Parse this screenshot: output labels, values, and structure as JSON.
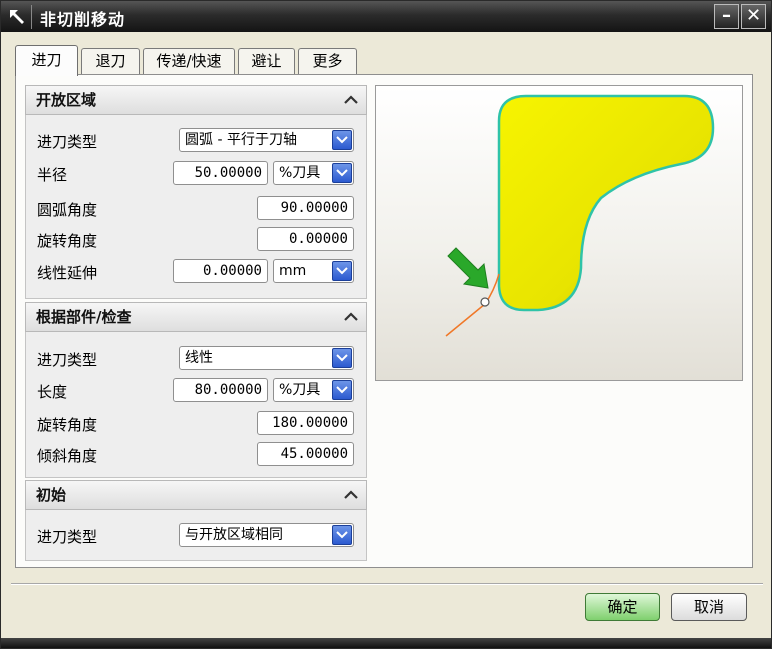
{
  "window": {
    "title": "非切削移动",
    "minimize_label": "–",
    "close_label": "✕"
  },
  "tabs": [
    {
      "label": "进刀",
      "active": true
    },
    {
      "label": "退刀",
      "active": false
    },
    {
      "label": "传递/快速",
      "active": false
    },
    {
      "label": "避让",
      "active": false
    },
    {
      "label": "更多",
      "active": false
    }
  ],
  "open_area": {
    "header": "开放区域",
    "entry_type_label": "进刀类型",
    "entry_type_value": "圆弧 - 平行于刀轴",
    "radius_label": "半径",
    "radius_value": "50.00000",
    "radius_unit": "%刀具",
    "arc_angle_label": "圆弧角度",
    "arc_angle_value": "90.00000",
    "rotation_angle_label": "旋转角度",
    "rotation_angle_value": "0.00000",
    "linear_extension_label": "线性延伸",
    "linear_extension_value": "0.00000",
    "linear_extension_unit": "mm"
  },
  "part_check": {
    "header": "根据部件/检查",
    "entry_type_label": "进刀类型",
    "entry_type_value": "线性",
    "length_label": "长度",
    "length_value": "80.00000",
    "length_unit": "%刀具",
    "rotation_angle_label": "旋转角度",
    "rotation_angle_value": "180.00000",
    "ramp_angle_label": "倾斜角度",
    "ramp_angle_value": "45.00000"
  },
  "initial": {
    "header": "初始",
    "entry_type_label": "进刀类型",
    "entry_type_value": "与开放区域相同"
  },
  "buttons": {
    "ok": "确定",
    "cancel": "取消"
  },
  "colors": {
    "shape_fill": "#f2ee00",
    "shape_outline": "#2fc3a8",
    "arrow": "#2aa82a",
    "path": "#f07828",
    "dropdown_button": "#3a66d8",
    "ok_button": "#8fd67d"
  }
}
